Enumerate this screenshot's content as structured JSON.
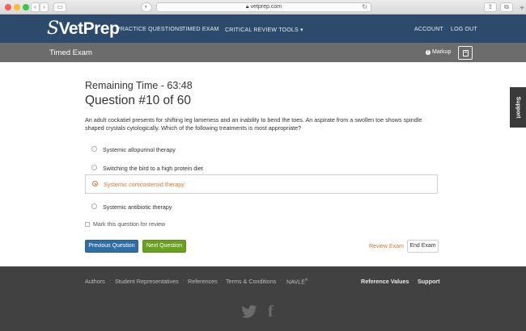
{
  "browser": {
    "url": "vetprep.com",
    "reload_icon": "reload-icon",
    "back_icon": "back-icon",
    "forward_icon": "forward-icon"
  },
  "nav": {
    "logo_s": "S",
    "logo_text": "VetPrep",
    "practice": "PRACTICE QUESTIONS",
    "timed": "TIMED EXAM",
    "critical": "CRITICAL REVIEW TOOLS ▾",
    "account": "ACCOUNT",
    "logout": "LOG OUT"
  },
  "subheader": {
    "title": "Timed Exam",
    "markup_label": "Markup",
    "calculator_icon": "calculator-icon"
  },
  "support": "Support",
  "exam": {
    "remaining": "Remaining Time - 63:48",
    "question_number": "Question #10 of 60",
    "stem": "An adult cockatiel presents for shifting leg lameness and an inability to bend the toes. An aspirate from a swollen toe shows spindle shaped crystals cytologically. Which of the following treatments is most appropriate?",
    "options": [
      {
        "label": "Systemic allopurinol therapy",
        "selected": false
      },
      {
        "label": "Switching the bird to a high protein diet",
        "selected": false
      },
      {
        "label": "Systemic corticosteroid therapy",
        "selected": true
      },
      {
        "label": "Systemic antibiotic therapy",
        "selected": false
      }
    ],
    "mark_review": "Mark this question for review",
    "prev": "Previous Question",
    "next": "Next Question",
    "review_exam": "Review Exam",
    "end_exam": "End Exam"
  },
  "footer": {
    "authors": "Authors",
    "students": "Student Representatives",
    "references": "References",
    "terms": "Terms & Conditions",
    "navle": "NAVLE",
    "reg": "®",
    "ref_values": "Reference Values",
    "support": "Support",
    "sep": "·",
    "twitter_icon": "twitter-icon",
    "facebook_icon": "facebook-icon"
  },
  "colors": {
    "nav_bg": "#2c4b6c",
    "subheader_bg": "#6c6c6c",
    "accent_orange": "#d8762e",
    "prev_button": "#2f6da4",
    "next_button": "#6a9f1f",
    "footer_bg": "#414141"
  }
}
